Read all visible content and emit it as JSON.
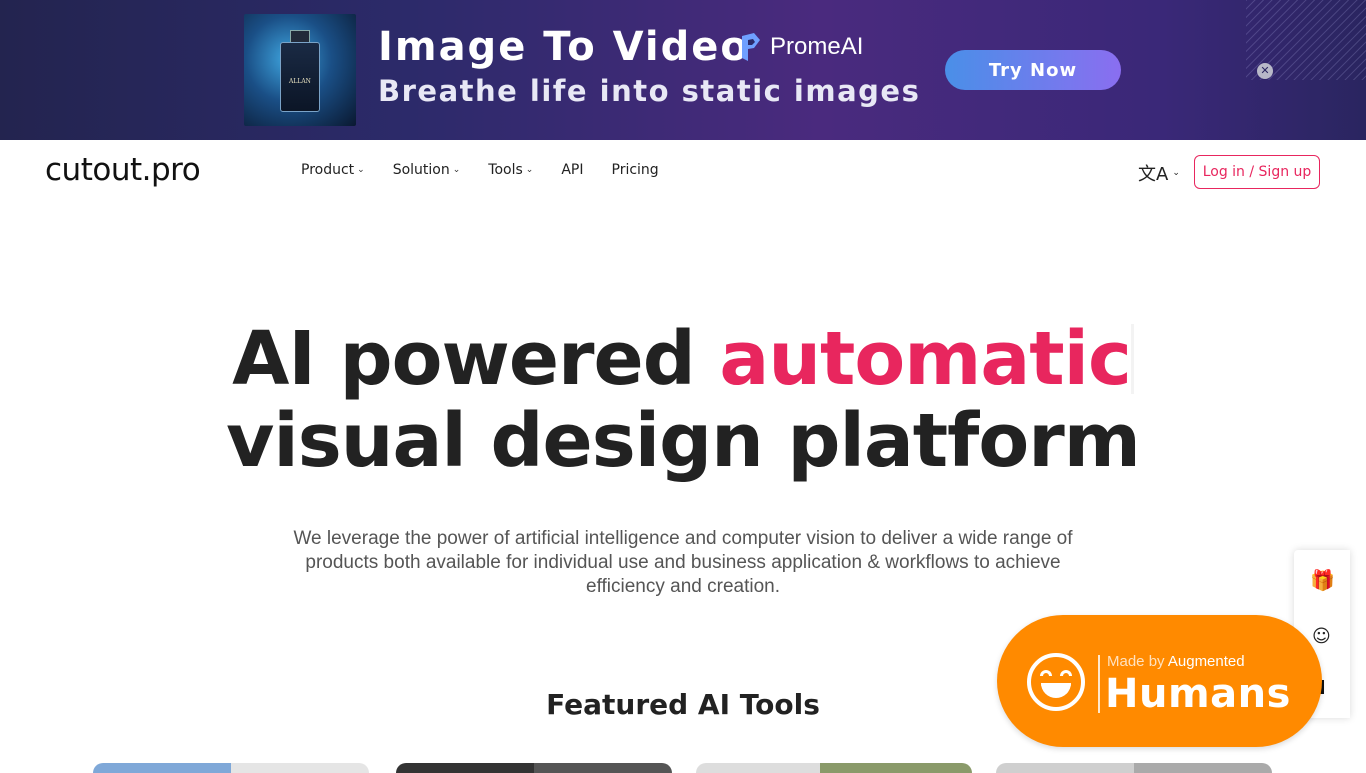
{
  "ad": {
    "title": "Image To Video",
    "subtitle": "Breathe life into static images",
    "brand": "PromeAI",
    "cta": "Try Now",
    "close": "✕",
    "product_label": "ALLAN"
  },
  "header": {
    "logo": "cutout.pro",
    "nav": [
      {
        "label": "Product",
        "has_dropdown": true
      },
      {
        "label": "Solution",
        "has_dropdown": true
      },
      {
        "label": "Tools",
        "has_dropdown": true
      },
      {
        "label": "API",
        "has_dropdown": false
      },
      {
        "label": "Pricing",
        "has_dropdown": false
      }
    ],
    "language_icon": "文A",
    "login_label": "Log in / Sign up"
  },
  "hero": {
    "title_prefix": "AI powered ",
    "title_accent": "automatic",
    "title_line2": "visual design platform",
    "description": "We leverage the power of artificial intelligence and computer vision to deliver a wide range of products both available for individual use and business application & workflows to achieve efficiency and creation."
  },
  "featured": {
    "title": "Featured AI Tools"
  },
  "badge": {
    "small_prefix": "Made by ",
    "small_strong": "Augmented",
    "big": "Humans"
  },
  "side_panel": {
    "gift_icon": "gift-icon",
    "support_icon": "support-agent-icon"
  },
  "colors": {
    "accent": "#e8265e",
    "badge": "#ff8a00",
    "text": "#222222"
  }
}
